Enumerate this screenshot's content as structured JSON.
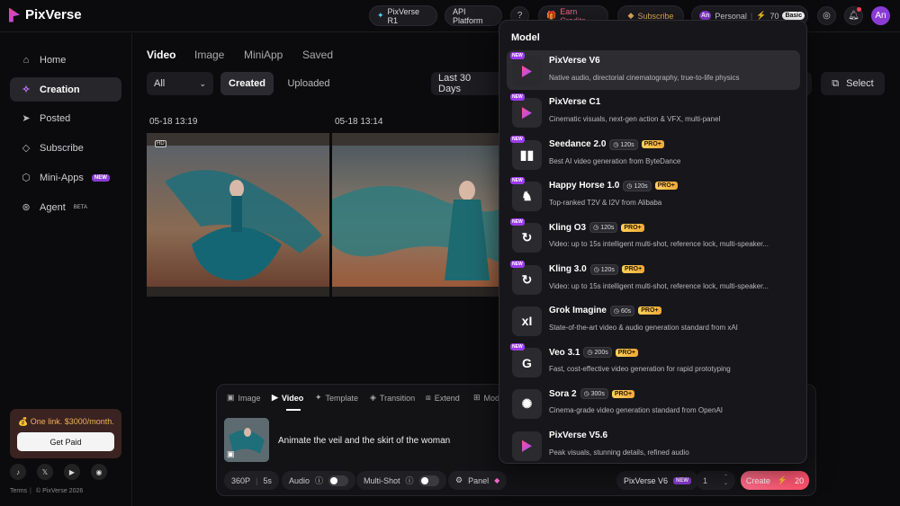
{
  "header": {
    "brand": "PixVerse",
    "pixverse_r1": "PixVerse R1",
    "api_platform": "API Platform",
    "help": "?",
    "earn_credits": "Earn Credits",
    "subscribe": "Subscribe",
    "personal": "Personal",
    "credits": "70",
    "plan": "Basic",
    "avatar": "An"
  },
  "sidebar": {
    "items": [
      {
        "label": "Home",
        "icon": "home-icon"
      },
      {
        "label": "Creation",
        "icon": "sparkle-icon"
      },
      {
        "label": "Posted",
        "icon": "send-icon"
      },
      {
        "label": "Subscribe",
        "icon": "diamond-icon"
      },
      {
        "label": "Mini-Apps",
        "icon": "cube-icon",
        "tag": "NEW"
      },
      {
        "label": "Agent",
        "icon": "agent-icon",
        "tag": "BETA"
      }
    ],
    "promo_text": "One link. $3000/month.",
    "promo_button": "Get Paid",
    "terms": "Terms",
    "copyright": "© PixVerse 2026"
  },
  "main": {
    "tabs": [
      "Video",
      "Image",
      "MiniApp",
      "Saved"
    ],
    "filter_all": "All",
    "filter_created": "Created",
    "filter_uploaded": "Uploaded",
    "date_range": "Last 30 Days",
    "select": "Select",
    "items": [
      {
        "date": "05-18 13:19",
        "badge": "HD"
      },
      {
        "date": "05-18 13:14",
        "badge": ""
      }
    ]
  },
  "composer": {
    "tabs": [
      "Image",
      "Video",
      "Template",
      "Transition",
      "Extend",
      "Mod"
    ],
    "prompt": "Animate the veil and the skirt of the woman",
    "resolution": "360P",
    "duration": "5s",
    "audio": "Audio",
    "multishot": "Multi-Shot",
    "panel": "Panel",
    "model": "PixVerse V6",
    "model_tag": "NEW",
    "count": "1",
    "create": "Create",
    "create_cost": "20"
  },
  "dropdown": {
    "title": "Model",
    "models": [
      {
        "name": "PixVerse V6",
        "desc": "Native audio, directorial cinematography, true-to-life physics",
        "new": true,
        "duration": "",
        "pro": false,
        "icon": "pixverse-icon",
        "glyph": ""
      },
      {
        "name": "PixVerse C1",
        "desc": "Cinematic visuals, next-gen action & VFX, multi-panel",
        "new": true,
        "duration": "",
        "pro": false,
        "icon": "pixverse-icon",
        "glyph": ""
      },
      {
        "name": "Seedance 2.0",
        "desc": "Best AI video generation from ByteDance",
        "new": true,
        "duration": "120s",
        "pro": true,
        "icon": "bytedance-icon",
        "glyph": "▮▮"
      },
      {
        "name": "Happy Horse 1.0",
        "desc": "Top-ranked T2V & I2V from Alibaba",
        "new": true,
        "duration": "120s",
        "pro": true,
        "icon": "horse-icon",
        "glyph": "♞"
      },
      {
        "name": "Kling O3",
        "desc": "Video: up to 15s intelligent multi-shot, reference lock, multi-speaker...",
        "new": true,
        "duration": "120s",
        "pro": true,
        "icon": "kling-icon",
        "glyph": "↻"
      },
      {
        "name": "Kling 3.0",
        "desc": "Video: up to 15s intelligent multi-shot, reference lock, multi-speaker...",
        "new": true,
        "duration": "120s",
        "pro": true,
        "icon": "kling-icon",
        "glyph": "↻"
      },
      {
        "name": "Grok Imagine",
        "desc": "State-of-the-art video & audio generation standard from xAI",
        "new": false,
        "duration": "60s",
        "pro": true,
        "icon": "xai-icon",
        "glyph": "xI"
      },
      {
        "name": "Veo 3.1",
        "desc": "Fast, cost-effective video generation for rapid prototyping",
        "new": true,
        "duration": "200s",
        "pro": true,
        "icon": "google-icon",
        "glyph": "G"
      },
      {
        "name": "Sora 2",
        "desc": "Cinema-grade video generation standard from OpenAI",
        "new": false,
        "duration": "300s",
        "pro": true,
        "icon": "openai-icon",
        "glyph": "✺"
      },
      {
        "name": "PixVerse V5.6",
        "desc": "Peak visuals, stunning details, refined audio",
        "new": false,
        "duration": "",
        "pro": false,
        "icon": "pixverse-icon",
        "glyph": ""
      }
    ],
    "pro_label": "PRO+",
    "new_label": "NEW"
  },
  "colors": {
    "accent": "#8a3bd4",
    "create": "#ff5f7a",
    "pro": "#f0a83a"
  }
}
